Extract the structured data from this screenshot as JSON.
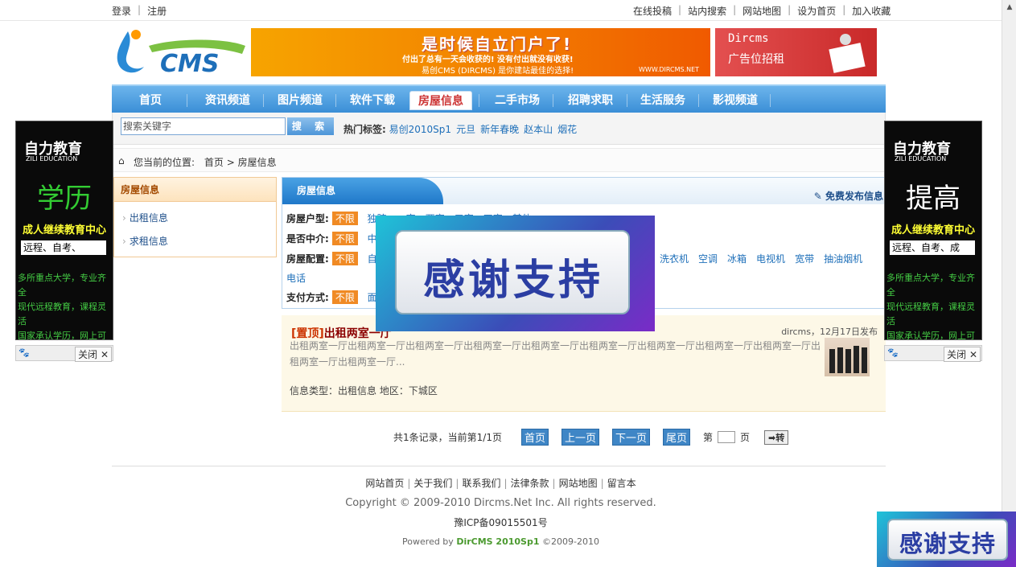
{
  "topbar": {
    "login": "登录",
    "register": "注册",
    "links": [
      "在线投稿",
      "站内搜索",
      "网站地图",
      "设为首页",
      "加入收藏"
    ]
  },
  "header": {
    "logo_text": "CMS",
    "banner": {
      "headline": "是时候自立门户了!",
      "line1": "付出了总有一天会收获的! 没有付出就没有收获!",
      "line2": "易创CMS (DIRCMS) 是你建站最佳的选择!",
      "url": "WWW.DIRCMS.NET"
    },
    "ad": {
      "brand": "Dircms",
      "text": "广告位招租"
    }
  },
  "nav": {
    "items": [
      "首页",
      "资讯频道",
      "图片频道",
      "软件下载",
      "房屋信息",
      "二手市场",
      "招聘求职",
      "生活服务",
      "影视频道"
    ],
    "active_index": 4
  },
  "search": {
    "placeholder": "搜索关键字",
    "button": "搜 索",
    "hot_label": "热门标签:",
    "hot_tags": [
      "易创2010Sp1",
      "元旦",
      "新年春晚",
      "赵本山",
      "烟花"
    ]
  },
  "breadcrumb": {
    "prefix": "您当前的位置:",
    "home": "首页",
    "current": "房屋信息"
  },
  "sidebar": {
    "title": "房屋信息",
    "items": [
      "出租信息",
      "求租信息"
    ]
  },
  "main": {
    "tab": "房屋信息",
    "publish": "免费发布信息",
    "filters": [
      {
        "label": "房屋户型:",
        "tag": "不限",
        "options": [
          "独院",
          "一室",
          "两室",
          "三室",
          "四室",
          "其他"
        ]
      },
      {
        "label": "是否中介:",
        "tag": "不限",
        "options": [
          "中介"
        ]
      },
      {
        "label": "房屋配置:",
        "tag": "不限",
        "options": [
          "自",
          "洗衣机",
          "空调",
          "冰箱",
          "电视机",
          "宽带",
          "抽油烟机",
          "电话"
        ]
      },
      {
        "label": "支付方式:",
        "tag": "不限",
        "options": [
          "面"
        ]
      }
    ],
    "listing": {
      "pin": "[置顶]",
      "title": "出租两室一厅",
      "meta": "dircms，12月17日发布",
      "desc": "出租两室一厅出租两室一厅出租两室一厅出租两室一厅出租两室一厅出租两室一厅出租两室一厅出租两室一厅出租两室一厅出租两室一厅出租两室一厅...",
      "info": "信息类型：出租信息 地区：下城区"
    }
  },
  "pager": {
    "summary": "共1条记录，当前第1/1页",
    "first": "首页",
    "prev": "上一页",
    "next": "下一页",
    "last": "尾页",
    "page_prefix": "第",
    "page_suffix": "页",
    "go": "➡转"
  },
  "footer": {
    "links": [
      "网站首页",
      "关于我们",
      "联系我们",
      "法律条款",
      "网站地图",
      "留言本"
    ],
    "copyright": "Copyright © 2009-2010 Dircms.Net Inc. All rights reserved.",
    "icp": "豫ICP备09015501号",
    "powered_prefix": "Powered by",
    "powered_name": "DirCMS 2010Sp1",
    "powered_suffix": "©2009-2010"
  },
  "side_ads": {
    "left": {
      "brand": "自力教育",
      "brand_en": "ZILI EDUCATION",
      "big": "学历",
      "sub": "成人继续教育中心",
      "box": "远程、自考、",
      "lines": [
        "多所重点大学，专业齐全",
        "现代远程教育，课程灵活",
        "国家承认学历，网上可查"
      ]
    },
    "right": {
      "brand": "自力教育",
      "brand_en": "ZILI EDUCATION",
      "big": "提高",
      "sub": "成人继续教育中心",
      "box": "远程、自考、成",
      "lines": [
        "多所重点大学，专业齐全",
        "现代远程教育，课程灵活",
        "国家承认学历，网上可查"
      ]
    },
    "close": "关闭 ✕"
  },
  "popup": {
    "text": "感谢支持"
  },
  "colors": {
    "nav": "#3a8ed6",
    "tag": "#f08a24",
    "listing_bg": "#fdf8e7",
    "popup": "#3b4db8"
  }
}
